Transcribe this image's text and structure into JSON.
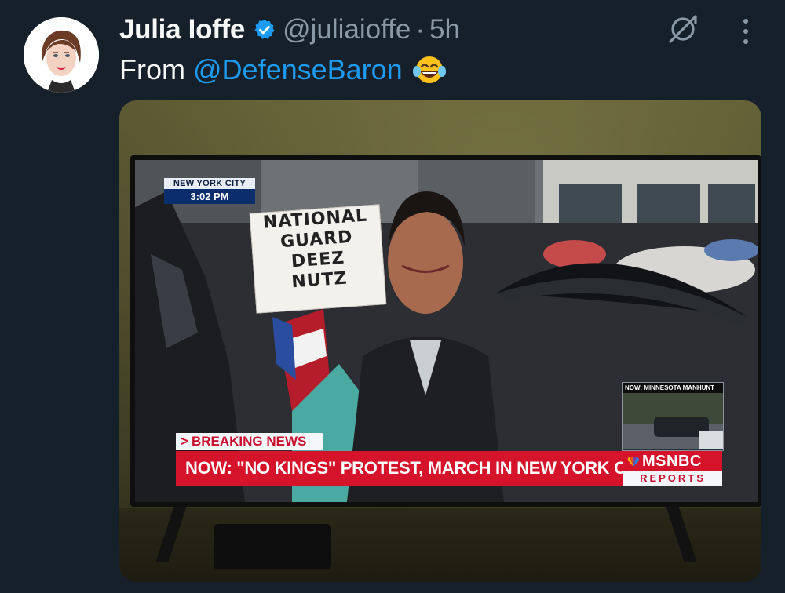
{
  "tweet": {
    "display_name": "Julia Ioffe",
    "handle": "@juliaioffe",
    "separator": "·",
    "age": "5h",
    "text_prefix": "From",
    "mention": "@DefenseBaron",
    "emoji": "laughing-crying-emoji"
  },
  "icons": {
    "verified": "verified-badge-icon",
    "grok": "grok-icon",
    "more": "more-options-icon"
  },
  "colors": {
    "background": "#15202b",
    "text_primary": "#f7f9f9",
    "text_secondary": "#8b98a5",
    "link": "#1d9bf0",
    "verified": "#1d9bf0",
    "breaking_red": "#d5132a"
  },
  "media": {
    "location_bug": {
      "city": "NEW YORK CITY",
      "time": "3:02 PM"
    },
    "sign_lines": [
      "NATIONAL",
      "GUARD",
      "DEEZ",
      "NUTZ"
    ],
    "pip_label": "NOW: MINNESOTA MANHUNT",
    "breaking_label": "BREAKING NEWS",
    "headline": "NOW: \"NO KINGS\" PROTEST, MARCH IN NEW YORK CITY",
    "network": "MSNBC",
    "network_sub": "REPORTS"
  }
}
